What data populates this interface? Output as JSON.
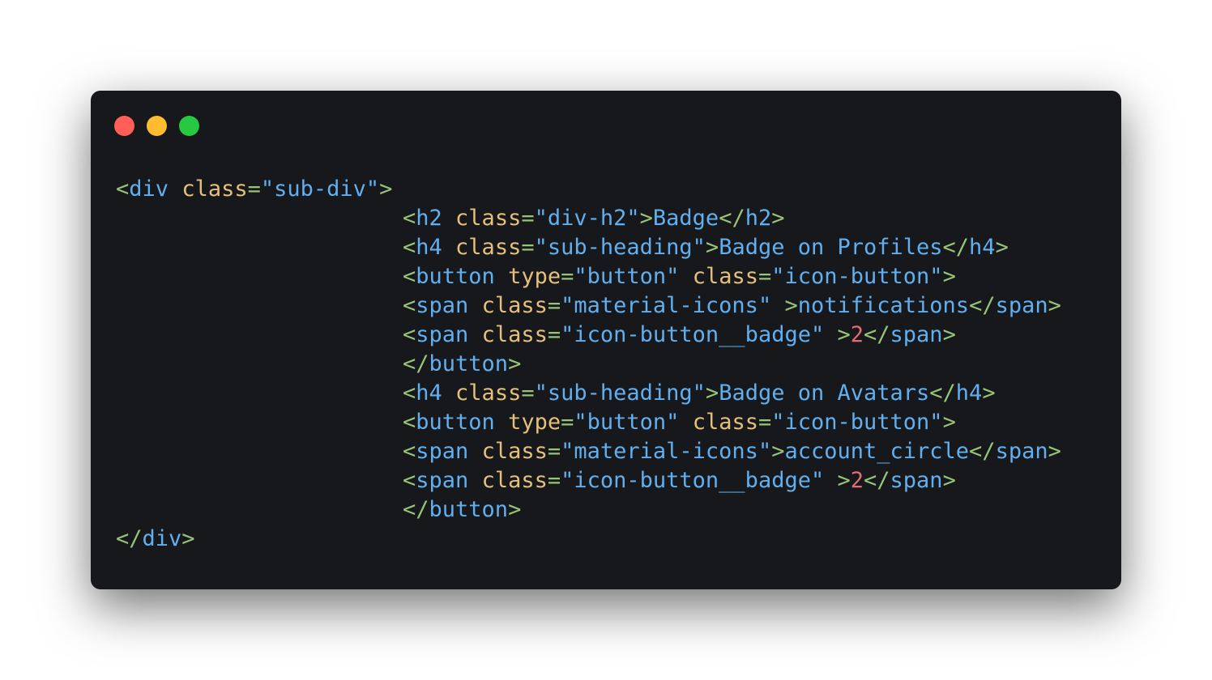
{
  "window": {
    "controls": [
      {
        "name": "close",
        "color": "#ff5f57"
      },
      {
        "name": "minimize",
        "color": "#febc2e"
      },
      {
        "name": "maximize",
        "color": "#28c840"
      }
    ]
  },
  "colors": {
    "punct": "#98c379",
    "tag": "#61afef",
    "attr": "#e5c07b",
    "string": "#61afef",
    "text": "#61afef",
    "number": "#e06c75"
  },
  "code_lines": [
    {
      "indent": false,
      "tokens": [
        {
          "t": "<",
          "k": "punct"
        },
        {
          "t": "div",
          "k": "tag"
        },
        {
          "t": " ",
          "k": "text"
        },
        {
          "t": "class",
          "k": "attr"
        },
        {
          "t": "=",
          "k": "punct"
        },
        {
          "t": "\"sub-div\"",
          "k": "string"
        },
        {
          "t": ">",
          "k": "punct"
        }
      ]
    },
    {
      "indent": true,
      "tokens": [
        {
          "t": "<",
          "k": "punct"
        },
        {
          "t": "h2",
          "k": "tag"
        },
        {
          "t": " ",
          "k": "text"
        },
        {
          "t": "class",
          "k": "attr"
        },
        {
          "t": "=",
          "k": "punct"
        },
        {
          "t": "\"div-h2\"",
          "k": "string"
        },
        {
          "t": ">",
          "k": "punct"
        },
        {
          "t": "Badge",
          "k": "text"
        },
        {
          "t": "</",
          "k": "punct"
        },
        {
          "t": "h2",
          "k": "tag"
        },
        {
          "t": ">",
          "k": "punct"
        }
      ]
    },
    {
      "indent": true,
      "tokens": [
        {
          "t": "<",
          "k": "punct"
        },
        {
          "t": "h4",
          "k": "tag"
        },
        {
          "t": " ",
          "k": "text"
        },
        {
          "t": "class",
          "k": "attr"
        },
        {
          "t": "=",
          "k": "punct"
        },
        {
          "t": "\"sub-heading\"",
          "k": "string"
        },
        {
          "t": ">",
          "k": "punct"
        },
        {
          "t": "Badge on Profiles",
          "k": "text"
        },
        {
          "t": "</",
          "k": "punct"
        },
        {
          "t": "h4",
          "k": "tag"
        },
        {
          "t": ">",
          "k": "punct"
        }
      ]
    },
    {
      "indent": true,
      "tokens": [
        {
          "t": "<",
          "k": "punct"
        },
        {
          "t": "button",
          "k": "tag"
        },
        {
          "t": " ",
          "k": "text"
        },
        {
          "t": "type",
          "k": "attr"
        },
        {
          "t": "=",
          "k": "punct"
        },
        {
          "t": "\"button\"",
          "k": "string"
        },
        {
          "t": " ",
          "k": "text"
        },
        {
          "t": "class",
          "k": "attr"
        },
        {
          "t": "=",
          "k": "punct"
        },
        {
          "t": "\"icon-button\"",
          "k": "string"
        },
        {
          "t": ">",
          "k": "punct"
        }
      ]
    },
    {
      "indent": true,
      "tokens": [
        {
          "t": "<",
          "k": "punct"
        },
        {
          "t": "span",
          "k": "tag"
        },
        {
          "t": " ",
          "k": "text"
        },
        {
          "t": "class",
          "k": "attr"
        },
        {
          "t": "=",
          "k": "punct"
        },
        {
          "t": "\"material-icons\"",
          "k": "string"
        },
        {
          "t": " ",
          "k": "text"
        },
        {
          "t": ">",
          "k": "punct"
        },
        {
          "t": "notifications",
          "k": "text"
        },
        {
          "t": "</",
          "k": "punct"
        },
        {
          "t": "span",
          "k": "tag"
        },
        {
          "t": ">",
          "k": "punct"
        }
      ]
    },
    {
      "indent": true,
      "tokens": [
        {
          "t": "<",
          "k": "punct"
        },
        {
          "t": "span",
          "k": "tag"
        },
        {
          "t": " ",
          "k": "text"
        },
        {
          "t": "class",
          "k": "attr"
        },
        {
          "t": "=",
          "k": "punct"
        },
        {
          "t": "\"icon-button__badge\"",
          "k": "string"
        },
        {
          "t": " ",
          "k": "text"
        },
        {
          "t": ">",
          "k": "punct"
        },
        {
          "t": "2",
          "k": "number"
        },
        {
          "t": "</",
          "k": "punct"
        },
        {
          "t": "span",
          "k": "tag"
        },
        {
          "t": ">",
          "k": "punct"
        }
      ]
    },
    {
      "indent": true,
      "tokens": [
        {
          "t": "</",
          "k": "punct"
        },
        {
          "t": "button",
          "k": "tag"
        },
        {
          "t": ">",
          "k": "punct"
        }
      ]
    },
    {
      "indent": true,
      "tokens": [
        {
          "t": "<",
          "k": "punct"
        },
        {
          "t": "h4",
          "k": "tag"
        },
        {
          "t": " ",
          "k": "text"
        },
        {
          "t": "class",
          "k": "attr"
        },
        {
          "t": "=",
          "k": "punct"
        },
        {
          "t": "\"sub-heading\"",
          "k": "string"
        },
        {
          "t": ">",
          "k": "punct"
        },
        {
          "t": "Badge on Avatars",
          "k": "text"
        },
        {
          "t": "</",
          "k": "punct"
        },
        {
          "t": "h4",
          "k": "tag"
        },
        {
          "t": ">",
          "k": "punct"
        }
      ]
    },
    {
      "indent": true,
      "tokens": [
        {
          "t": "<",
          "k": "punct"
        },
        {
          "t": "button",
          "k": "tag"
        },
        {
          "t": " ",
          "k": "text"
        },
        {
          "t": "type",
          "k": "attr"
        },
        {
          "t": "=",
          "k": "punct"
        },
        {
          "t": "\"button\"",
          "k": "string"
        },
        {
          "t": " ",
          "k": "text"
        },
        {
          "t": "class",
          "k": "attr"
        },
        {
          "t": "=",
          "k": "punct"
        },
        {
          "t": "\"icon-button\"",
          "k": "string"
        },
        {
          "t": ">",
          "k": "punct"
        }
      ]
    },
    {
      "indent": true,
      "tokens": [
        {
          "t": "<",
          "k": "punct"
        },
        {
          "t": "span",
          "k": "tag"
        },
        {
          "t": " ",
          "k": "text"
        },
        {
          "t": "class",
          "k": "attr"
        },
        {
          "t": "=",
          "k": "punct"
        },
        {
          "t": "\"material-icons\"",
          "k": "string"
        },
        {
          "t": ">",
          "k": "punct"
        },
        {
          "t": "account_circle",
          "k": "text"
        },
        {
          "t": "</",
          "k": "punct"
        },
        {
          "t": "span",
          "k": "tag"
        },
        {
          "t": ">",
          "k": "punct"
        }
      ]
    },
    {
      "indent": true,
      "tokens": [
        {
          "t": "<",
          "k": "punct"
        },
        {
          "t": "span",
          "k": "tag"
        },
        {
          "t": " ",
          "k": "text"
        },
        {
          "t": "class",
          "k": "attr"
        },
        {
          "t": "=",
          "k": "punct"
        },
        {
          "t": "\"icon-button__badge\"",
          "k": "string"
        },
        {
          "t": " ",
          "k": "text"
        },
        {
          "t": ">",
          "k": "punct"
        },
        {
          "t": "2",
          "k": "number"
        },
        {
          "t": "</",
          "k": "punct"
        },
        {
          "t": "span",
          "k": "tag"
        },
        {
          "t": ">",
          "k": "punct"
        }
      ]
    },
    {
      "indent": true,
      "tokens": [
        {
          "t": "</",
          "k": "punct"
        },
        {
          "t": "button",
          "k": "tag"
        },
        {
          "t": ">",
          "k": "punct"
        }
      ]
    },
    {
      "indent": false,
      "tokens": [
        {
          "t": "</",
          "k": "punct"
        },
        {
          "t": "div",
          "k": "tag"
        },
        {
          "t": ">",
          "k": "punct"
        }
      ]
    }
  ]
}
